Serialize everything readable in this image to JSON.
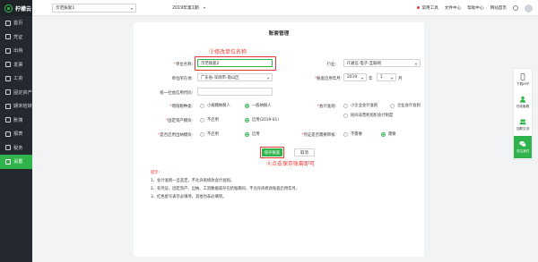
{
  "app": {
    "name": "柠檬云"
  },
  "sidebar": {
    "items": [
      {
        "label": "首页",
        "icon": "home-icon"
      },
      {
        "label": "凭证",
        "icon": "voucher-icon"
      },
      {
        "label": "出纳",
        "icon": "cashier-icon"
      },
      {
        "label": "发票",
        "icon": "invoice-icon"
      },
      {
        "label": "工资",
        "icon": "salary-icon"
      },
      {
        "label": "固定资产",
        "icon": "asset-icon"
      },
      {
        "label": "期末结转",
        "icon": "period-end-icon"
      },
      {
        "label": "账簿",
        "icon": "ledger-icon"
      },
      {
        "label": "报表",
        "icon": "report-icon"
      },
      {
        "label": "税务",
        "icon": "tax-icon"
      },
      {
        "label": "设置",
        "icon": "settings-icon",
        "active": true
      }
    ]
  },
  "topbar": {
    "account_select": "示范账套1",
    "period": "2019年第1期",
    "right": {
      "ticket": "常用工具",
      "download": "文件中心",
      "help": "帮助中心",
      "website": "网站首页"
    }
  },
  "form": {
    "title": "账套管理",
    "unit_name_label": "单位名称:",
    "unit_name_value": "示范账套2",
    "industry_label": "行业:",
    "industry_value": "IT通信-电子-互联网",
    "location_label": "单位所在地:",
    "location_value": "广东省-深圳市-南山区",
    "start_period_label": "账套启用年月:",
    "start_year": "2019",
    "year_unit": "年",
    "start_month": "1",
    "month_unit": "月",
    "credit_code_label": "统一社会信用代码:",
    "credit_code_value": "",
    "taxpayer_label": "增值税种类:",
    "taxpayer_options": [
      "小规模纳税人",
      "一般纳税人"
    ],
    "accounting_label": "会计准则:",
    "accounting_options": [
      "小企业会计准则",
      "企业会计准则",
      "民间非营利组织会计制度"
    ],
    "fixed_asset_label": "固定资产模块:",
    "fixed_asset_options": [
      "不启用",
      "启用(2019-01)"
    ],
    "cashier_label": "是否启用出纳模块:",
    "cashier_options": [
      "不启用",
      "启用"
    ],
    "review_label": "凭证是否需要审核:",
    "review_options": [
      "不需要",
      "需要"
    ]
  },
  "annotations": {
    "step3": "③修改单位名称",
    "step4": "④点击保存账套即可"
  },
  "buttons": {
    "save": "保存账套",
    "cancel": "取消"
  },
  "tips": {
    "title": "提示:",
    "lines": [
      "1、会计准则一旦选定，不允许再修改会计准则。",
      "2、有凭证、固定资产、出纳、工资数据或存在结账期间，不允许再修改账套启用年月。",
      "3、红色星号表示必填项，其他为非必填项。"
    ]
  },
  "right_panel": {
    "items": [
      {
        "label": "下载APP",
        "icon": "phone-icon"
      },
      {
        "label": "在线客服",
        "icon": "user-icon"
      },
      {
        "label": "加群交流",
        "icon": "group-icon"
      },
      {
        "label": "关注我们",
        "icon": "wechat-icon"
      }
    ]
  }
}
